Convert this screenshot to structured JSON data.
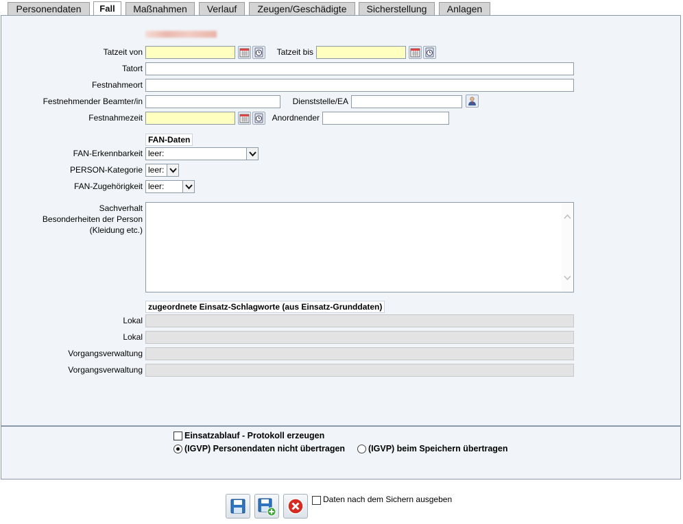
{
  "tabs": [
    {
      "label": "Personendaten"
    },
    {
      "label": "Fall"
    },
    {
      "label": "Maßnahmen"
    },
    {
      "label": "Verlauf"
    },
    {
      "label": "Zeugen/Geschädigte"
    },
    {
      "label": "Sicherstellung"
    },
    {
      "label": "Anlagen"
    }
  ],
  "form": {
    "tatzeit_von": {
      "label": "Tatzeit von",
      "value": ""
    },
    "tatzeit_bis": {
      "label": "Tatzeit bis",
      "value": ""
    },
    "tatort": {
      "label": "Tatort",
      "value": ""
    },
    "festnahmeort": {
      "label": "Festnahmeort",
      "value": ""
    },
    "beamter": {
      "label": "Festnehmender Beamter/in",
      "value": ""
    },
    "dienststelle": {
      "label": "Dienststelle/EA",
      "value": ""
    },
    "festnahmezeit": {
      "label": "Festnahmezeit",
      "value": ""
    },
    "anordnender": {
      "label": "Anordnender",
      "value": ""
    },
    "fan_section": "FAN-Daten",
    "fan_erkennbarkeit": {
      "label": "FAN-Erkennbarkeit",
      "value": "leer:"
    },
    "person_kategorie": {
      "label": "PERSON-Kategorie",
      "value": "leer:"
    },
    "fan_zugehoerigkeit": {
      "label": "FAN-Zugehörigkeit",
      "value": "leer:"
    },
    "sachverhalt": {
      "label_line1": "Sachverhalt",
      "label_line2": "Besonderheiten der Person",
      "label_line3": "(Kleidung etc.)",
      "value": ""
    },
    "schlagworte_section": "zugeordnete Einsatz-Schlagworte (aus Einsatz-Grunddaten)",
    "schlagworte": [
      {
        "label": "Lokal",
        "value": ""
      },
      {
        "label": "Lokal",
        "value": ""
      },
      {
        "label": "Vorgangsverwaltung",
        "value": ""
      },
      {
        "label": "Vorgangsverwaltung",
        "value": ""
      }
    ]
  },
  "options": {
    "protokoll": "Einsatzablauf - Protokoll erzeugen",
    "igvp_nicht": "(IGVP) Personendaten nicht übertragen",
    "igvp_speichern": "(IGVP) beim Speichern übertragen"
  },
  "footer": {
    "ausgeben": "Daten nach dem Sichern ausgeben"
  }
}
